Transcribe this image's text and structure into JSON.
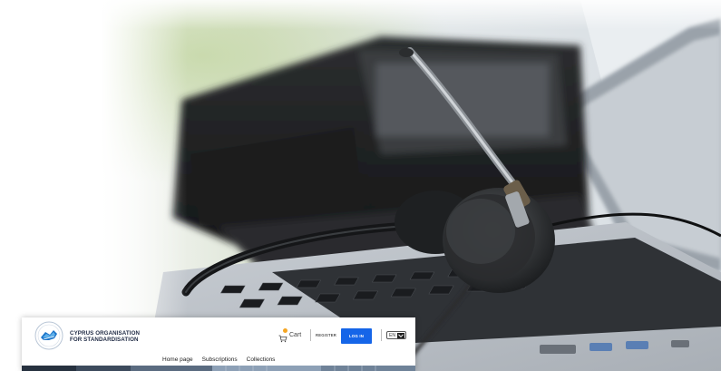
{
  "site": {
    "org_name_line1": "CYPRUS ORGANISATION",
    "org_name_line2": "FOR STANDARDISATION",
    "cart_label": "Cart",
    "register_label": "REGISTER",
    "login_label": "LOG IN",
    "language": "EN",
    "nav": [
      "Home page",
      "Subscriptions",
      "Collections"
    ]
  },
  "icons": [
    "cys-logo",
    "cart-icon",
    "chevron-down-icon"
  ],
  "colors": {
    "login_button": "#1565e8",
    "cart_badge": "#f5a623",
    "logo_text": "#1f2a44"
  }
}
